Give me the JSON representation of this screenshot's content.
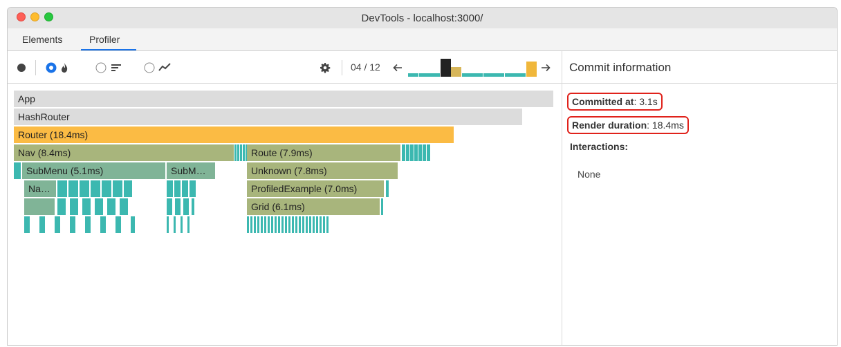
{
  "window": {
    "title": "DevTools - localhost:3000/"
  },
  "tabs": [
    {
      "label": "Elements"
    },
    {
      "label": "Profiler"
    }
  ],
  "toolbar": {
    "commit_counter": "04 / 12",
    "commit_bars": [
      {
        "value": 0.2,
        "color": "#3cb8b0"
      },
      {
        "value": 0.2,
        "color": "#3cb8b0"
      },
      {
        "value": 0.2,
        "color": "#3cb8b0"
      },
      {
        "value": 1.0,
        "color": "#222222"
      },
      {
        "value": 0.55,
        "color": "#d7b65a"
      },
      {
        "value": 0.2,
        "color": "#3cb8b0"
      },
      {
        "value": 0.2,
        "color": "#3cb8b0"
      },
      {
        "value": 0.2,
        "color": "#3cb8b0"
      },
      {
        "value": 0.2,
        "color": "#3cb8b0"
      },
      {
        "value": 0.2,
        "color": "#3cb8b0"
      },
      {
        "value": 0.2,
        "color": "#3cb8b0"
      },
      {
        "value": 0.85,
        "color": "#f0b73b"
      }
    ]
  },
  "commit_info": {
    "title": "Commit information",
    "committed_at_label": "Committed at",
    "committed_at_value": ": 3.1s",
    "render_duration_label": "Render duration",
    "render_duration_value": ": 18.4ms",
    "interactions_label": "Interactions:",
    "interactions_value": "None"
  },
  "flame": {
    "app": "App",
    "hashrouter": "HashRouter",
    "router": "Router (18.4ms)",
    "nav": "Nav (8.4ms)",
    "route": "Route (7.9ms)",
    "submenu": "SubMenu (5.1ms)",
    "subm2": "SubM…",
    "unknown": "Unknown (7.8ms)",
    "na": "Na…",
    "profiled": "ProfiledExample (7.0ms)",
    "grid": "Grid (6.1ms)"
  },
  "colors": {
    "accent": "#1a73e8",
    "router": "#fbbb44",
    "gray_bar": "#dcdcdc",
    "olive": "#a8b57c",
    "teal": "#3cb8b0",
    "green_gray": "#80b497",
    "highlight": "#e0221b"
  }
}
